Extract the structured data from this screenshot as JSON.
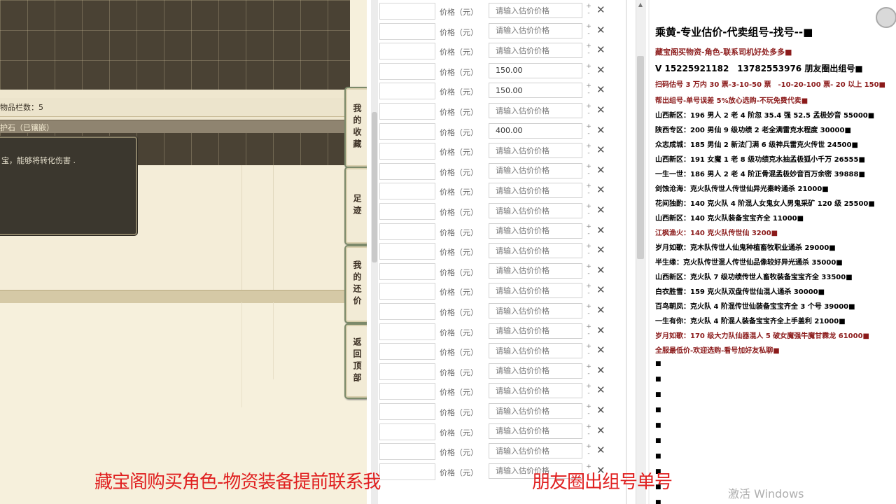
{
  "game": {
    "slot_count_label": "物品栏数：5",
    "item_name_label": "护石（已镶嵌）",
    "tooltip_text": "宝，能够将转化伤害 .",
    "side_tabs": [
      {
        "label": "我的收藏"
      },
      {
        "label": "足迹"
      },
      {
        "label": "我的还价"
      },
      {
        "label": "返回顶部"
      }
    ]
  },
  "price_list": {
    "label": "价格（元）",
    "placeholder": "请输入估价价格",
    "rows": [
      {
        "value": ""
      },
      {
        "value": ""
      },
      {
        "value": ""
      },
      {
        "value": "150.00"
      },
      {
        "value": "150.00"
      },
      {
        "value": ""
      },
      {
        "value": "400.00"
      },
      {
        "value": ""
      },
      {
        "value": ""
      },
      {
        "value": ""
      },
      {
        "value": ""
      },
      {
        "value": ""
      },
      {
        "value": ""
      },
      {
        "value": ""
      },
      {
        "value": ""
      },
      {
        "value": ""
      },
      {
        "value": ""
      },
      {
        "value": ""
      },
      {
        "value": ""
      },
      {
        "value": ""
      },
      {
        "value": ""
      },
      {
        "value": ""
      },
      {
        "value": ""
      },
      {
        "value": ""
      }
    ],
    "stepper_up": "+",
    "stepper_down": "-",
    "close_glyph": "✕"
  },
  "ad_panel": {
    "title": "乘黄-专业估价-代卖组号-找号--■",
    "lines": [
      {
        "text": "藏宝阁买物资-角色-联系司机好处多多■",
        "color": "#8b1a1a",
        "size": 11
      },
      {
        "text": "V 15225921182　13782553976 朋友圈出组号■",
        "color": "#000000",
        "size": 12
      },
      {
        "text": "扫码估号 3 万内 30 票-3-10-50 票　-10-20-100 票- 20 以上 150■",
        "color": "#8b1a1a",
        "size": 10
      },
      {
        "text": "帮出组号-单号误差 5%放心选购-不玩免费代卖■",
        "color": "#8b1a1a",
        "size": 10
      },
      {
        "text": "山西新区：196 男人 2 老 4 阶忽 35.4 强 52.5 孟极妙音 55000■",
        "color": "#000000",
        "size": 10
      },
      {
        "text": "陕西专区：200 男仙 9 级功绩 2 老全满雷克水程度 30000■",
        "color": "#000000",
        "size": 10
      },
      {
        "text": "众志成城：185 男仙 2 新法门满 6 级神兵雷克火传世 24500■",
        "color": "#000000",
        "size": 10
      },
      {
        "text": "山西新区：191 女魔 1 老 8 级功绩克水抽孟极狐小千万 26555■",
        "color": "#000000",
        "size": 10
      },
      {
        "text": "一生一世：186 男人 2 老 4 阶正骨混孟极妙音百万余密 39888■",
        "color": "#000000",
        "size": 10
      },
      {
        "text": "剑蚀沧海：克火队传世人传世仙异光秦岭通杀 21000■",
        "color": "#000000",
        "size": 10
      },
      {
        "text": "花间独酌：140 克火队 4 阶混人女鬼女人男鬼采矿 120 级 25500■",
        "color": "#000000",
        "size": 10
      },
      {
        "text": "山西新区：140 克火队装备宝宝齐全 11000■",
        "color": "#000000",
        "size": 10
      },
      {
        "text": "江枫渔火：140 克火队传世仙 3200■",
        "color": "#8b1a1a",
        "size": 10
      },
      {
        "text": "岁月如歌：克木队传世人仙鬼种植畜牧职业通杀 29000■",
        "color": "#000000",
        "size": 10
      },
      {
        "text": "半生缘：克火队传世混人传世仙品像较好异光通杀 35000■",
        "color": "#000000",
        "size": 10
      },
      {
        "text": "山西新区：克火队 7 级功绩传世人畜牧装备宝宝齐全 33500■",
        "color": "#000000",
        "size": 10
      },
      {
        "text": "白衣胜雪：159 克火队双盘传世仙混人通杀 30000■",
        "color": "#000000",
        "size": 10
      },
      {
        "text": "百鸟朝凤：克火队 4 阶混传世仙装备宝宝齐全 3 个号 39000■",
        "color": "#000000",
        "size": 10
      },
      {
        "text": "一生有你：克火队 4 阶混人装备宝宝齐全上手盖利 21000■",
        "color": "#000000",
        "size": 10
      },
      {
        "text": "岁月如歌：170 级大力队仙器混人 5 破女魔强牛魔甘霖龙 61000■",
        "color": "#8b1a1a",
        "size": 10
      },
      {
        "text": "全服最低价-欢迎选购-看号加好友私聊■",
        "color": "#8b1a1a",
        "size": 10
      }
    ],
    "bullets": [
      "■",
      "■",
      "■",
      "■",
      "■",
      "■",
      "■",
      "■",
      "■",
      "■"
    ]
  },
  "banner": {
    "left_text": "藏宝阁购买角色-物资装备提前联系我",
    "right_text": "朋友圈出组号单号",
    "color": "#e02020"
  },
  "watermark": "激活 Windows"
}
